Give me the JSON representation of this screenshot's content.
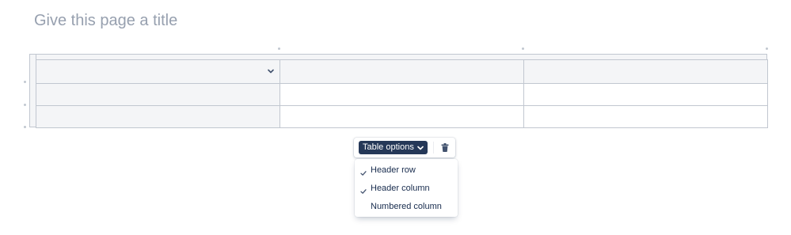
{
  "page": {
    "title_placeholder": "Give this page a title"
  },
  "table": {
    "rows": 3,
    "columns": 3,
    "header_row": true,
    "header_column": true
  },
  "toolbar": {
    "table_options_label": "Table options",
    "table_options_icon": "chevron-down-icon",
    "delete_icon": "trash-icon"
  },
  "table_options_menu": {
    "items": [
      {
        "label": "Header row",
        "checked": true
      },
      {
        "label": "Header column",
        "checked": true
      },
      {
        "label": "Numbered column",
        "checked": false
      }
    ]
  },
  "colors": {
    "header_cell_bg": "#f4f5f7",
    "border": "#c1c7d0",
    "button_bg": "#253858",
    "text": "#172b4d",
    "placeholder": "#97a0af"
  }
}
